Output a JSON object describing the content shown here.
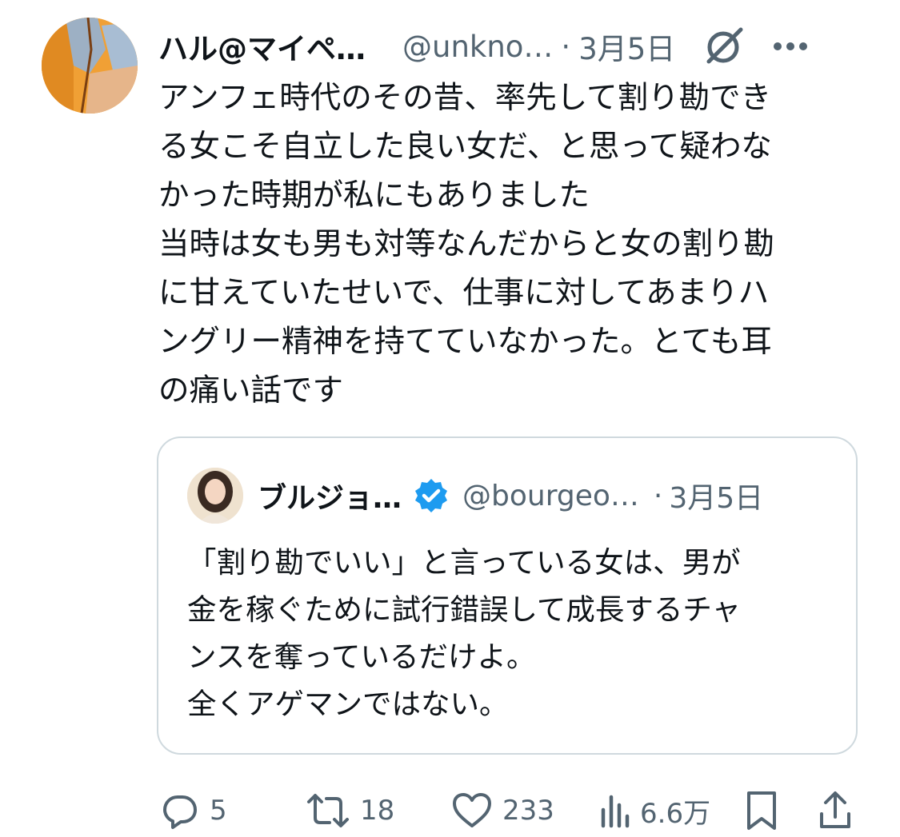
{
  "tweet": {
    "author_name": "ハル@マイペ…",
    "author_handle": "@unkno…",
    "separator": "·",
    "date": "3月5日",
    "text_lines": [
      "アンフェ時代のその昔、率先して割り勘でき",
      "る女こそ自立した良い女だ、と思って疑わな",
      "かった時期が私にもありました",
      "当時は女も男も対等なんだからと女の割り勘",
      "に甘えていたせいで、仕事に対してあまりハ",
      "ングリー精神を持てていなかった。とても耳",
      "の痛い話です"
    ]
  },
  "quoted_tweet": {
    "author_name": "ブルジョ…",
    "verified": true,
    "author_handle": "@bourgeo…",
    "separator": "·",
    "date": "3月5日",
    "text_lines": [
      "「割り勘でいい」と言っている女は、男が",
      "金を稼ぐために試行錯誤して成長するチャ",
      "ンスを奪っているだけよ。",
      "全くアゲマンではない。"
    ]
  },
  "actions": {
    "replies": "5",
    "retweets": "18",
    "likes": "233",
    "views": "6.6万"
  },
  "icons": {
    "grok": "grok-icon",
    "more": "more-icon",
    "verified": "verified-badge-icon",
    "reply": "reply-icon",
    "retweet": "retweet-icon",
    "like": "heart-icon",
    "views": "views-icon",
    "bookmark": "bookmark-icon",
    "share": "share-icon"
  },
  "colors": {
    "text_primary": "#0f1419",
    "text_secondary": "#536471",
    "border": "#cfd9de",
    "verified_blue": "#1d9bf0"
  }
}
